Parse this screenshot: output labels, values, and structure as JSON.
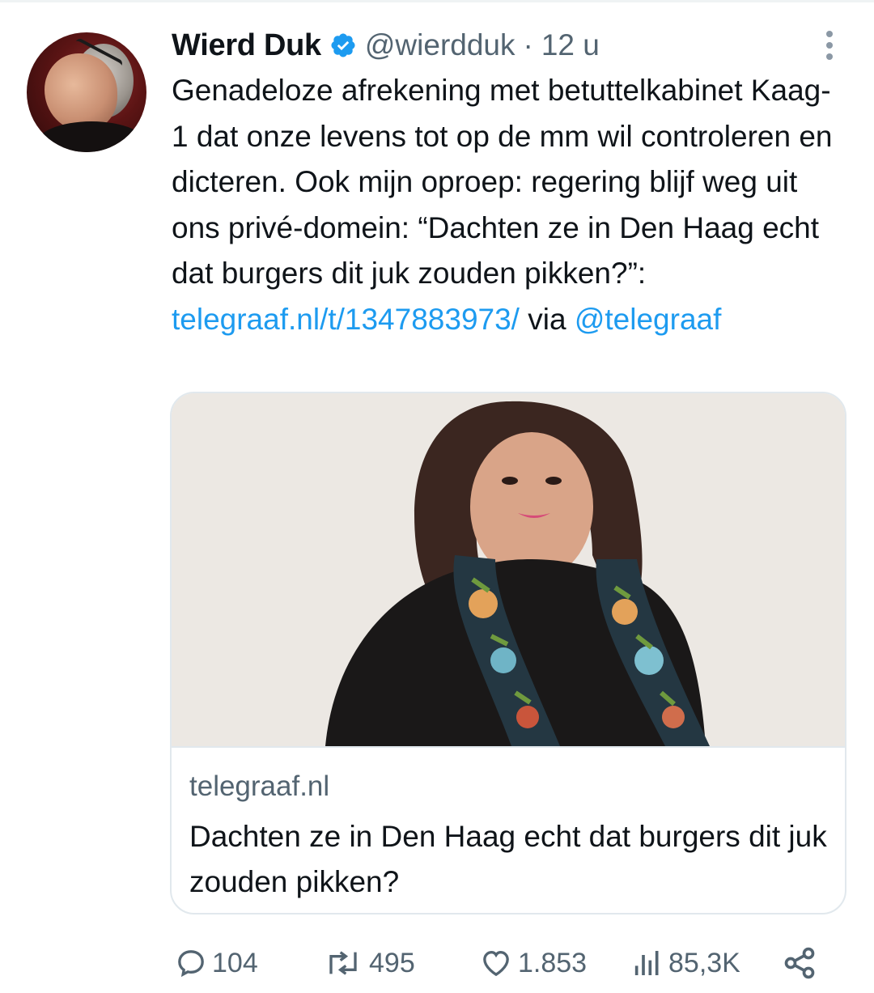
{
  "tweet": {
    "author_name": "Wierd Duk",
    "handle": "@wierdduk",
    "separator": "·",
    "time": "12 u",
    "text_before_link": "Genadeloze afrekening met betuttelkabinet Kaag-1 dat onze levens tot op de mm wil controleren en dicteren. Ook mijn oproep: regering blijf weg uit ons privé-domein: “Dachten ze in Den Haag echt dat burgers dit juk zouden pikken?”: ",
    "link_text": "telegraaf.nl/t/1347883973/",
    "via_text": " via ",
    "mention": "@telegraaf"
  },
  "card": {
    "domain": "telegraaf.nl",
    "title": "Dachten ze in Den Haag echt dat burgers dit juk zouden pikken?"
  },
  "actions": {
    "replies": "104",
    "retweets": "495",
    "likes": "1.853",
    "views": "85,3K"
  },
  "icons": {
    "verified": "verified-badge-icon",
    "more": "more-options-icon",
    "reply": "reply-icon",
    "retweet": "retweet-icon",
    "like": "heart-icon",
    "views": "views-chart-icon",
    "share": "share-icon"
  },
  "colors": {
    "link": "#1d9bf0",
    "muted": "#536471",
    "text": "#0f1419",
    "border": "#e1e8ed"
  }
}
